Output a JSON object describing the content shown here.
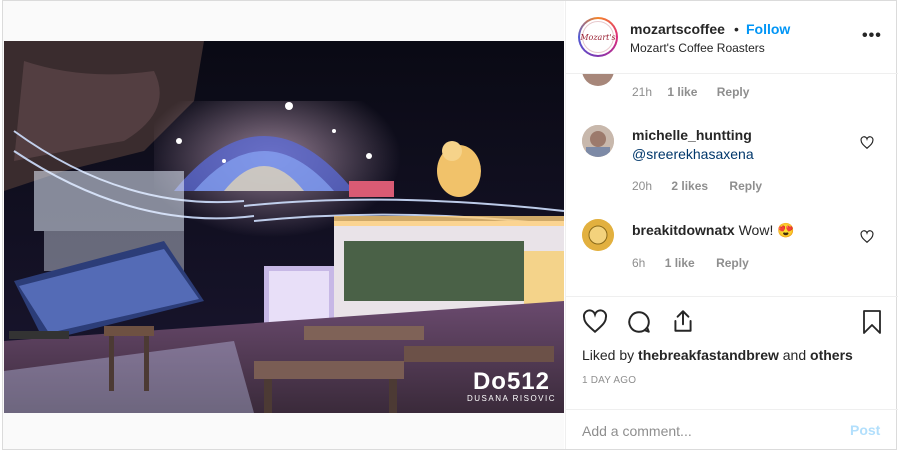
{
  "header": {
    "username": "mozartscoffee",
    "separator": "•",
    "follow_label": "Follow",
    "subtitle": "Mozart's Coffee Roasters",
    "more_label": "•••",
    "avatar_text": "Mozart's"
  },
  "photo": {
    "watermark_main": "Do512",
    "watermark_credit": "DUSANA RISOVIC"
  },
  "comments": [
    {
      "time": "21h",
      "likes": "1 like",
      "reply": "Reply"
    },
    {
      "username": "michelle_huntting",
      "text": "@sreerekhasaxena",
      "time": "20h",
      "likes": "2 likes",
      "reply": "Reply"
    },
    {
      "username": "breakitdownatx",
      "text": "Wow! 😍",
      "time": "6h",
      "likes": "1 like",
      "reply": "Reply"
    }
  ],
  "actions": {
    "liked_prefix": "Liked by",
    "liked_user": "thebreakfastandbrew",
    "liked_and": "and",
    "liked_others": "others",
    "date": "1 DAY AGO"
  },
  "add_comment": {
    "placeholder": "Add a comment...",
    "post_label": "Post"
  },
  "colors": {
    "follow": "#0095f6",
    "post_disabled": "#b2dffc",
    "muted": "#8e8e8e"
  }
}
